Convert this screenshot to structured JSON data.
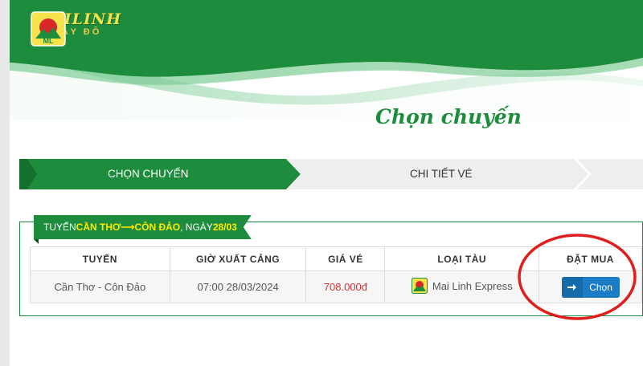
{
  "brand": {
    "name": "MAILINH",
    "subtitle": "TÂY ĐÔ",
    "logo_initials": "ML"
  },
  "page": {
    "title": "Chọn chuyến"
  },
  "steps": [
    {
      "label": "CHỌN CHUYẾN",
      "active": true
    },
    {
      "label": "CHI TIẾT VÉ",
      "active": false
    }
  ],
  "route_banner": {
    "prefix": "TUYẾN ",
    "origin": "CẦN THƠ",
    "arrow": " ⟶ ",
    "destination": "CÔN ĐẢO",
    "date_prefix": ", NGÀY ",
    "date": "28/03"
  },
  "table": {
    "headers": [
      "TUYẾN",
      "GIỜ XUẤT CẢNG",
      "GIÁ VÉ",
      "LOẠI TÀU",
      "ĐẶT MUA"
    ],
    "rows": [
      {
        "route": "Cần Thơ - Côn Đảo",
        "departure": "07:00 28/03/2024",
        "price": "708.000đ",
        "vessel": "Mai Linh Express",
        "action_label": "Chọn"
      }
    ]
  },
  "colors": {
    "brand_green": "#1d8c3c",
    "highlight_yellow": "#ffea00",
    "price_red": "#d32f2f",
    "button_blue": "#1b7bc4",
    "annotation_red": "#e01e1e"
  }
}
